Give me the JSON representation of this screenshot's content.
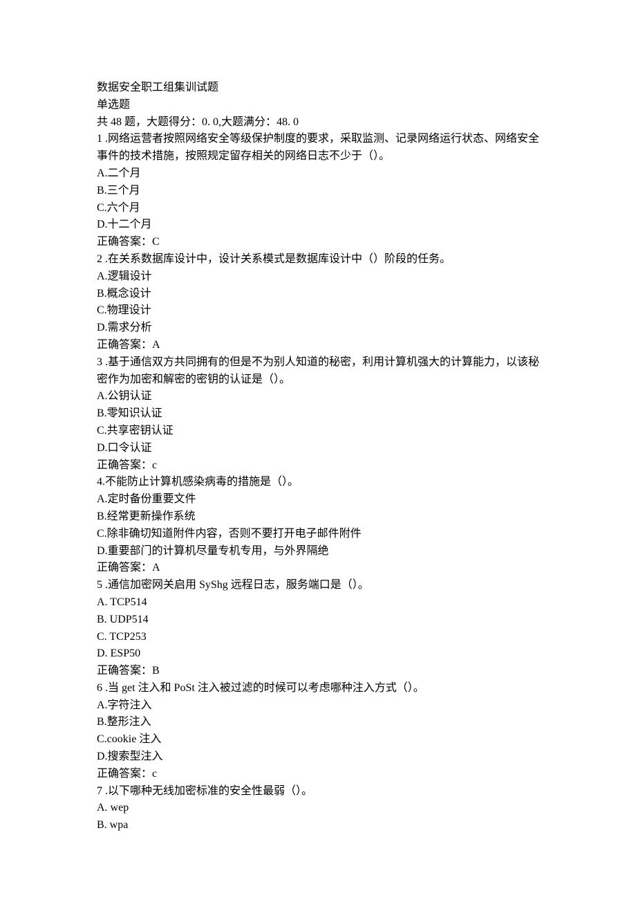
{
  "title": "数据安全职工组集训试题",
  "section": "单选题",
  "summary": "共 48 题，大题得分：0. 0,大题满分：48. 0",
  "questions": [
    {
      "num": "1",
      "text": "1 .网络运营者按照网络安全等级保护制度的要求，采取监测、记录网络运行状态、网络安全事件的技术措施，按照规定留存相关的网络日志不少于（）。",
      "options": [
        "A.二个月",
        "B.三个月",
        "C.六个月",
        "D.十二个月"
      ],
      "answer": "正确答案：C"
    },
    {
      "num": "2",
      "text": "2 .在关系数据库设计中，设计关系模式是数据库设计中（）阶段的任务。",
      "options": [
        "A.逻辑设计",
        "B.概念设计",
        "C.物理设计",
        "D.需求分析"
      ],
      "answer": "正确答案：A"
    },
    {
      "num": "3",
      "text": "3 .基于通信双方共同拥有的但是不为别人知道的秘密，利用计算机强大的计算能力，以该秘密作为加密和解密的密钥的认证是（）。",
      "options": [
        "A.公钥认证",
        "B.零知识认证",
        "C.共享密钥认证",
        "D.口令认证"
      ],
      "answer": "正确答案：c"
    },
    {
      "num": "4",
      "text": "4.不能防止计算机感染病毒的措施是（）。",
      "options": [
        "A.定时备份重要文件",
        "B.经常更新操作系统",
        "C.除非确切知道附件内容，否则不要打开电子邮件附件",
        "D.重要部门的计算机尽量专机专用，与外界隔绝"
      ],
      "answer": "正确答案：A"
    },
    {
      "num": "5",
      "text": "5 .通信加密网关启用 SyShg 远程日志，服务端口是（）。",
      "options": [
        "A. TCP514",
        "B. UDP514",
        "C. TCP253",
        "D. ESP50"
      ],
      "answer": "正确答案：B"
    },
    {
      "num": "6",
      "text": "6 .当 get 注入和 PoSt 注入被过滤的时候可以考虑哪种注入方式（）。",
      "options": [
        "A.字符注入",
        "B.整形注入",
        "C.cookie 注入",
        "D.搜索型注入"
      ],
      "answer": "正确答案：c"
    },
    {
      "num": "7",
      "text": "7 .以下哪种无线加密标准的安全性最弱（）。",
      "options": [
        "A. wep",
        "B. wpa"
      ],
      "answer": ""
    }
  ]
}
